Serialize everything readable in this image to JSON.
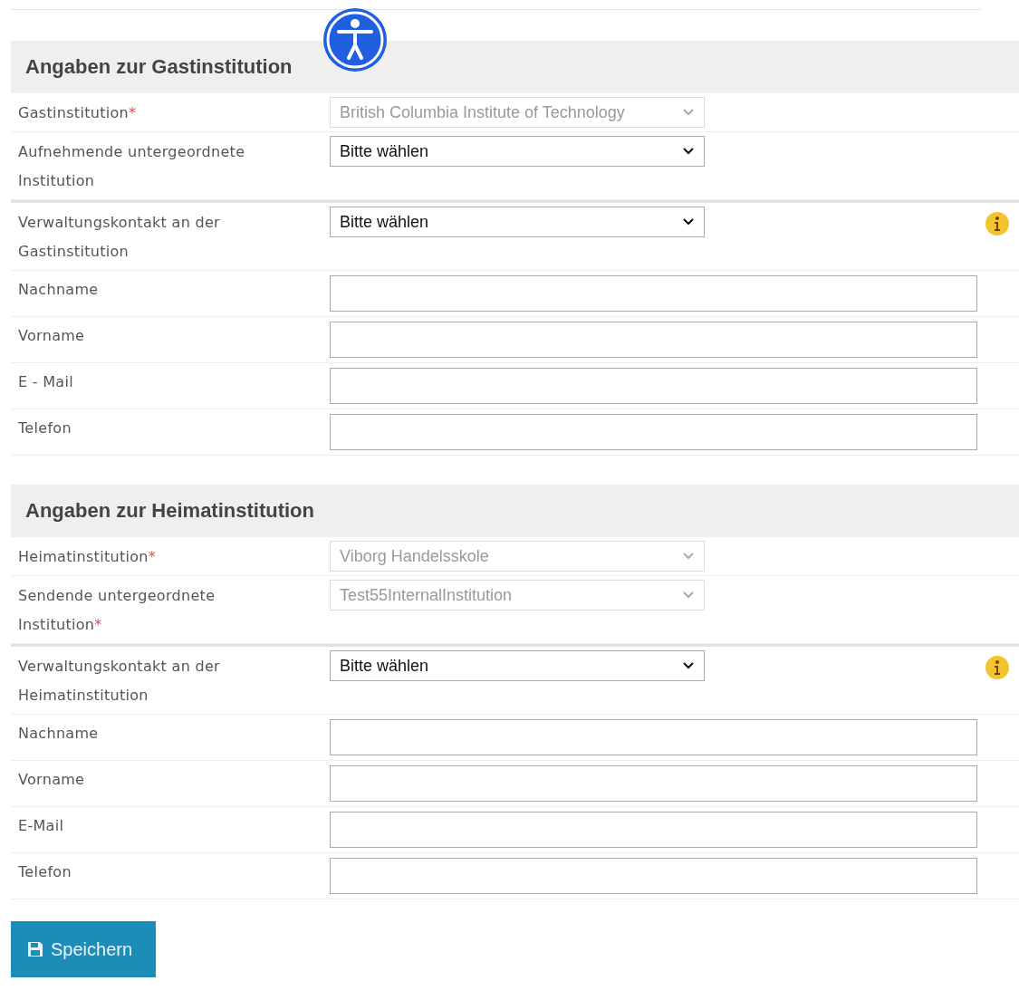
{
  "sections": [
    {
      "title": "Angaben zur Gastinstitution",
      "groups": [
        [
          {
            "kind": "select",
            "label": "Gastinstitution",
            "required_mark": "*",
            "value": "British Columbia Institute of Technology",
            "disabled": true,
            "info": false
          },
          {
            "kind": "select",
            "label": "Aufnehmende untergeordnete Institution",
            "value": "Bitte wählen",
            "disabled": false,
            "info": false
          }
        ],
        [
          {
            "kind": "select",
            "label": "Verwaltungskontakt an der Gastinstitution",
            "value": "Bitte wählen",
            "disabled": false,
            "info": true
          },
          {
            "kind": "text",
            "label": "Nachname"
          },
          {
            "kind": "text",
            "label": "Vorname"
          },
          {
            "kind": "text",
            "label": "E - Mail"
          },
          {
            "kind": "text",
            "label": "Telefon"
          }
        ]
      ]
    },
    {
      "title": "Angaben zur Heimatinstitution",
      "groups": [
        [
          {
            "kind": "select",
            "label": "Heimatinstitution",
            "required_mark": "*",
            "value": "Viborg Handelsskole",
            "disabled": true,
            "info": false
          },
          {
            "kind": "select",
            "label": "Sendende untergeordnete Institution",
            "required_mark": "*",
            "value": "Test55InternalInstitution",
            "disabled": true,
            "info": false
          }
        ],
        [
          {
            "kind": "select",
            "label": "Verwaltungskontakt an der Heimatinstitution",
            "value": "Bitte wählen",
            "disabled": false,
            "info": true
          },
          {
            "kind": "text",
            "label": "Nachname"
          },
          {
            "kind": "text",
            "label": "Vorname"
          },
          {
            "kind": "text",
            "label": "E-Mail"
          },
          {
            "kind": "text",
            "label": "Telefon"
          }
        ]
      ]
    }
  ],
  "save_button": {
    "label": "Speichern"
  }
}
